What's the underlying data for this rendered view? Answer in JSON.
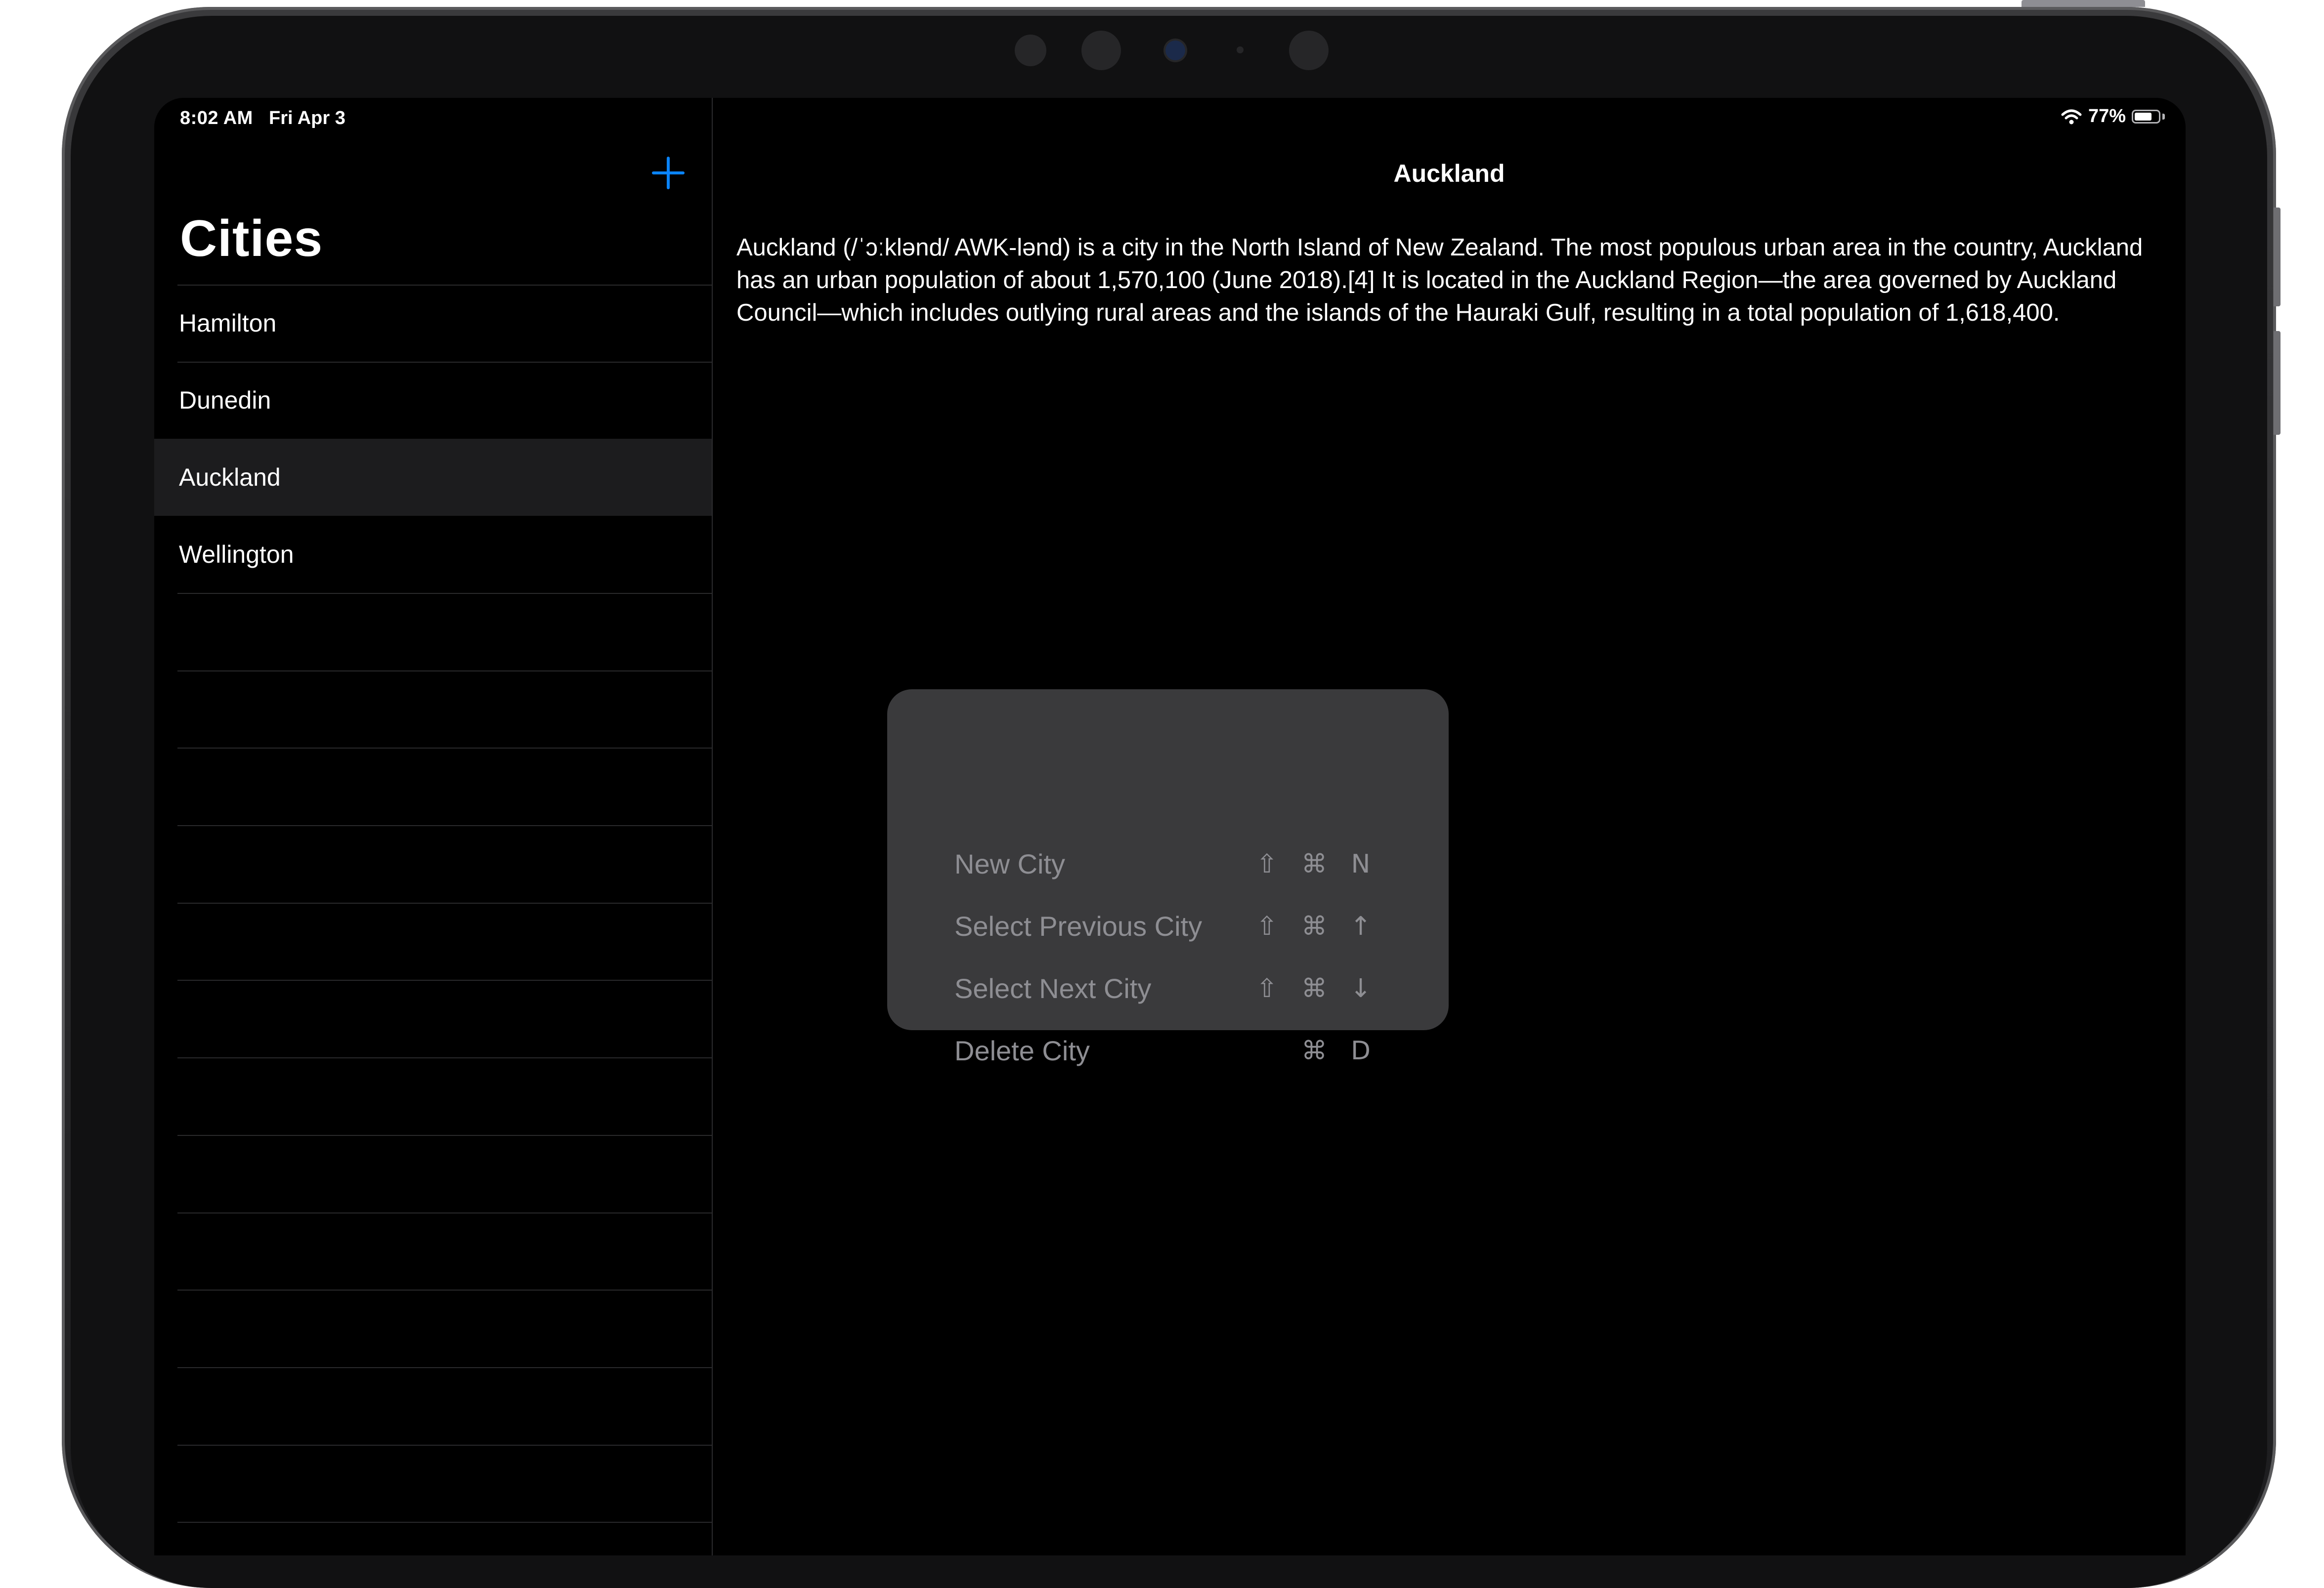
{
  "status_bar": {
    "time": "8:02 AM",
    "date": "Fri Apr 3",
    "battery_label": "77%",
    "battery_level": 0.77
  },
  "sidebar": {
    "title": "Cities",
    "add_icon": "plus-icon",
    "accent_color": "#0a84ff",
    "cities": [
      "Hamilton",
      "Dunedin",
      "Auckland",
      "Wellington"
    ],
    "selected": "Auckland"
  },
  "detail": {
    "title": "Auckland",
    "body": "Auckland (/ˈɔːklənd/ AWK-lənd) is a city in the North Island of New Zealand. The most populous urban area in the country, Auckland has an urban population of about 1,570,100 (June 2018).[4] It is located in the Auckland Region—the area governed by Auckland Council—which includes outlying rural areas and the islands of the Hauraki Gulf, resulting in a total population of 1,618,400."
  },
  "shortcuts": {
    "items": [
      {
        "label": "New City",
        "keys": [
          "⇧",
          "⌘",
          "N"
        ]
      },
      {
        "label": "Select Previous City",
        "keys": [
          "⇧",
          "⌘",
          "↑"
        ]
      },
      {
        "label": "Select Next City",
        "keys": [
          "⇧",
          "⌘",
          "↓"
        ]
      },
      {
        "label": "Delete City",
        "keys": [
          "⌘",
          "D"
        ]
      }
    ]
  }
}
